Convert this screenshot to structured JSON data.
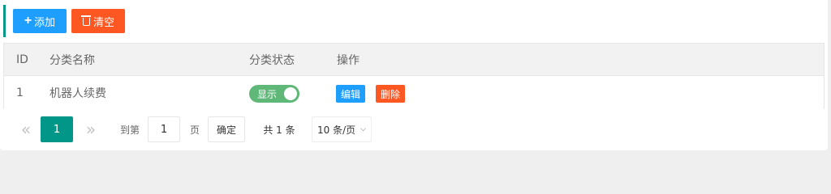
{
  "toolbar": {
    "add_label": "添加",
    "clear_label": "清空",
    "add_icon": "plus-icon",
    "clear_icon": "trash-icon"
  },
  "table": {
    "headers": [
      "ID",
      "分类名称",
      "分类状态",
      "操作"
    ],
    "rows": [
      {
        "id": "1",
        "name": "机器人续费",
        "status_label": "显示",
        "status_on": true,
        "edit_label": "编辑",
        "delete_label": "删除"
      }
    ]
  },
  "pagination": {
    "prev_icon": "«",
    "current_page": "1",
    "next_icon": "»",
    "goto_label": "到第",
    "goto_value": "1",
    "page_label": "页",
    "confirm_label": "确定",
    "total_label": "共 1 条",
    "limit_label": "10 条/页"
  },
  "colors": {
    "primary": "#1e9fff",
    "danger": "#ff5722",
    "accent": "#009688",
    "switch_on": "#5fb878"
  }
}
